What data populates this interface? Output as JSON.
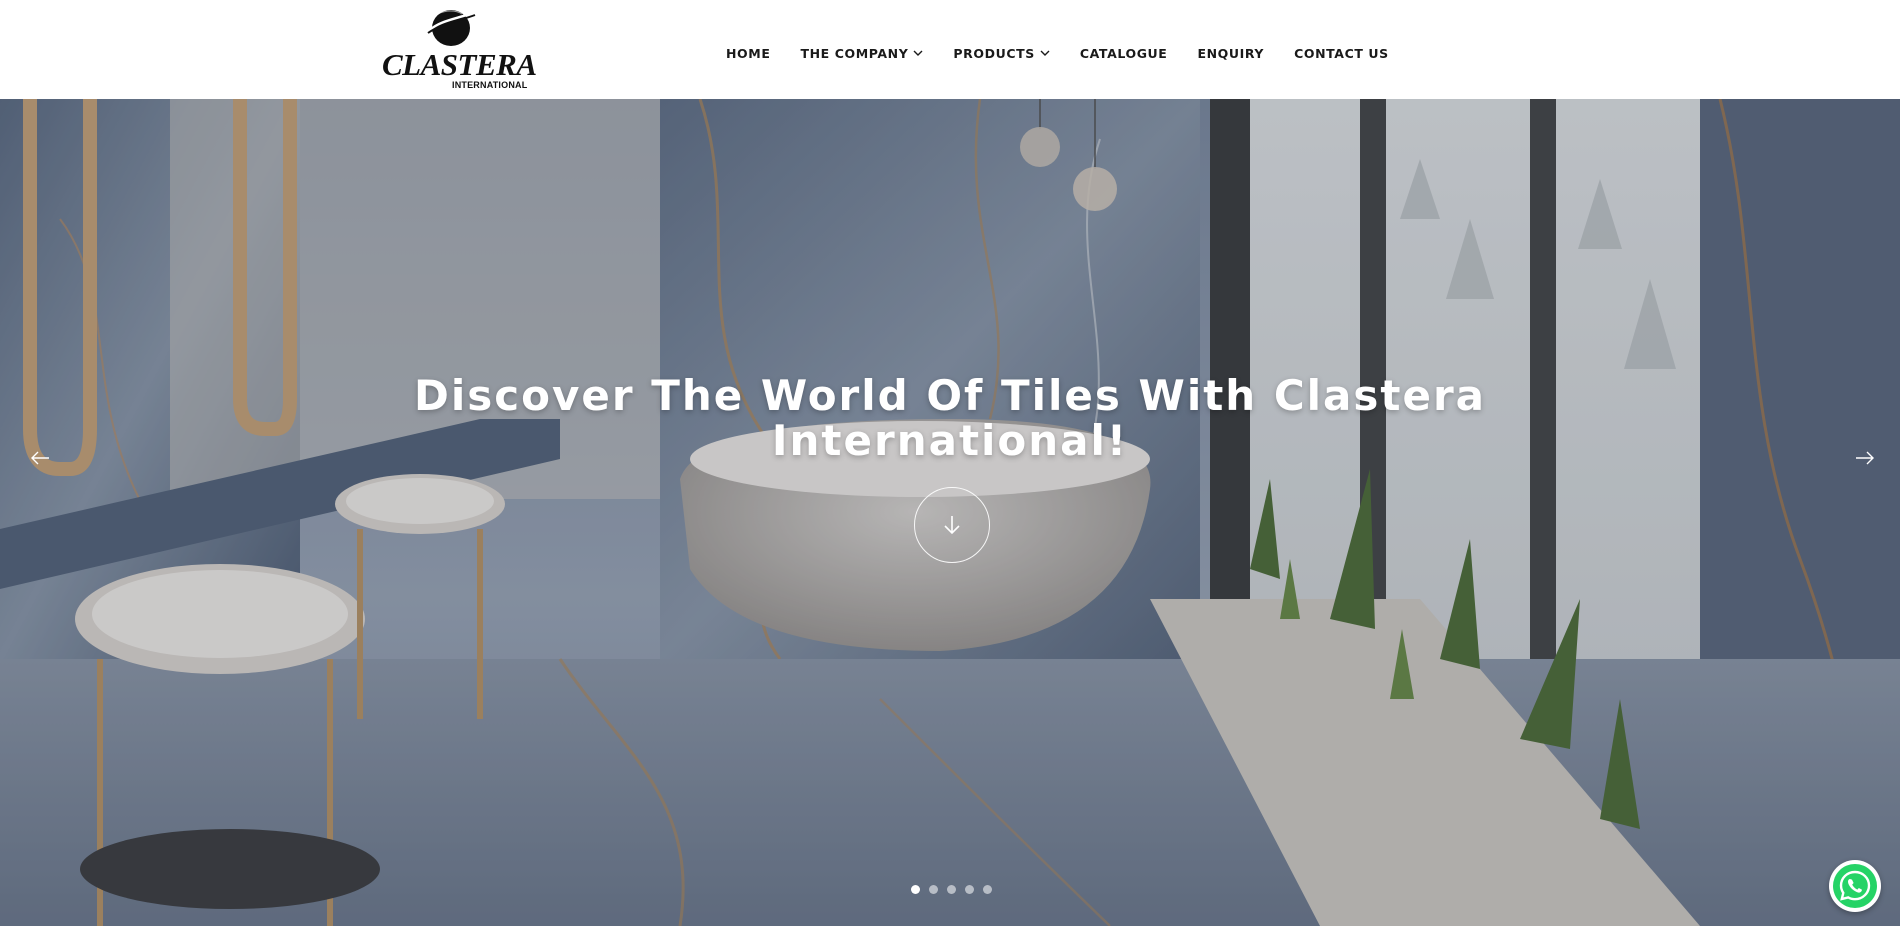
{
  "brand": {
    "name": "CLASTERA",
    "tagline": "INTERNATIONAL"
  },
  "nav": {
    "items": [
      {
        "label": "HOME",
        "has_dropdown": false
      },
      {
        "label": "THE COMPANY",
        "has_dropdown": true
      },
      {
        "label": "PRODUCTS",
        "has_dropdown": true
      },
      {
        "label": "CATALOGUE",
        "has_dropdown": false
      },
      {
        "label": "ENQUIRY",
        "has_dropdown": false
      },
      {
        "label": "CONTACT US",
        "has_dropdown": false
      }
    ]
  },
  "hero": {
    "title_line1": "Discover The World Of Tiles With Clastera",
    "title_line2": "International!",
    "slides_count": 5,
    "active_slide": 1,
    "icons": {
      "prev": "arrow-left-icon",
      "next": "arrow-right-icon",
      "scroll": "arrow-down-icon"
    }
  },
  "floating": {
    "icon": "whatsapp-icon",
    "color": "#25D366"
  },
  "colors": {
    "nav_text": "#1a1a1a",
    "header_bg": "#ffffff",
    "hero_text": "#ffffff"
  }
}
